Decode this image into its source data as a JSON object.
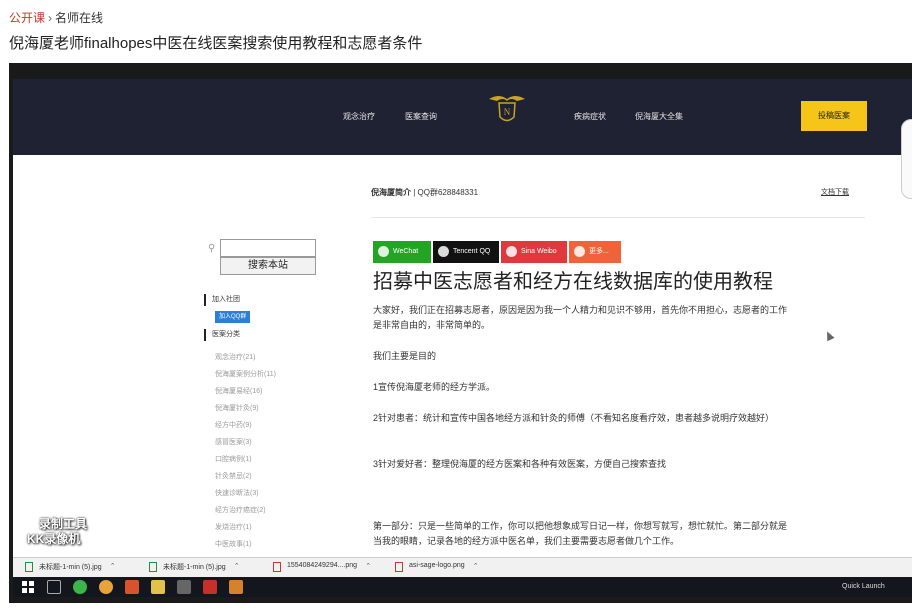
{
  "breadcrumb": {
    "home": "公开课",
    "separator": "›",
    "current": "名师在线"
  },
  "page_title": "倪海厦老师finalhopes中医在线医案搜索使用教程和志愿者条件",
  "site": {
    "nav_left": [
      "观念治疗",
      "医案查询"
    ],
    "nav_right": [
      "疾病症状",
      "倪海厦大全集"
    ],
    "post_button": "投稿医案",
    "intro_name": "倪海厦简介",
    "intro_sep": " | ",
    "intro_qq": "QQ群628848331",
    "docs_link": "文档下载"
  },
  "sidebar": {
    "search_button": "搜索本站",
    "join_heading": "加入社团",
    "qq_badge": "加入QQ群",
    "category_heading": "医案分类",
    "categories": [
      "观念治疗(21)",
      "倪海厦案例分析(11)",
      "倪海厦易经(16)",
      "倪海厦针灸(9)",
      "经方中药(9)",
      "感冒医案(3)",
      "口腔病例(1)",
      "针灸禁忌(2)",
      "快速诊断法(3)",
      "经方治疗癌症(2)",
      "发烧治疗(1)",
      "中医故事(1)"
    ]
  },
  "watermark": {
    "line1": "录制工具",
    "line2": "KK录像机"
  },
  "share": [
    "WeChat",
    "Tencent QQ",
    "Sina Weibo",
    "更多..."
  ],
  "article": {
    "title": "招募中医志愿者和经方在线数据库的使用教程",
    "p1": "大家好，我们正在招募志愿者，原因是因为我一个人精力和见识不够用，首先你不用担心，志愿者的工作是非常自由的，非常简单的。",
    "p2": "我们主要是目的",
    "p3": "1宣传倪海厦老师的经方学派。",
    "p4": "2针对患者：统计和宣传中国各地经方派和针灸的师傅（不看知名度看疗效，患者越多说明疗效越好）",
    "p5": "3针对爱好者：整理倪海厦的经方医案和各种有效医案，方便自己搜索查找",
    "p6": "第一部分：只是一些简单的工作，你可以把他想象成写日记一样，你想写就写，想忙就忙。第二部分就是当我的眼睛，记录各地的经方派中医名单，我们主要需要志愿者做几个工作。"
  },
  "downloads": [
    "未标题-1-min (5).jpg",
    "未标题-1-min (5).jpg",
    "1554084249294....png",
    "asi-sage-logo.png"
  ],
  "taskbar": {
    "quick_launch": "Quick Launch"
  },
  "colors": {
    "accent": "#c0392b",
    "header_bg": "#1f2233",
    "post_button": "#f5c518",
    "wechat": "#23a524",
    "tencent": "#111111",
    "weibo": "#e0383c",
    "more": "#f0633a"
  }
}
